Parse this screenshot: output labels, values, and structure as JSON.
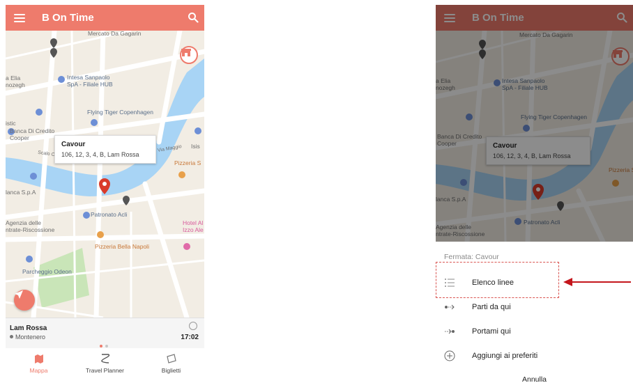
{
  "app": {
    "title": "B On Time"
  },
  "map_labels": {
    "mercato": "Mercato Da Gagarin",
    "elia": "a Elia\nnozegh",
    "intesa": "Intesa Sanpaolo\nSpA - Filiale HUB",
    "flying": "Flying Tiger Copenhagen",
    "banca_credito": "Banca Di Credito\nCooper",
    "istic": "istic",
    "banca_spa": "lanca S.p.A",
    "agenzia": "Agenzia delle\nntrate-Riscossione",
    "patronato": "Patronato Acli",
    "pizzeria_napoli": "Pizzeria Bella Napoli",
    "parcheggio": "Parcheggio Odeon",
    "hotel": "Hotel Al\nIzzo Ale",
    "pizzeria_s": "Pizzeria S",
    "via_maggio": "Via Maggio",
    "isis": "Isis",
    "scalo": "Scalo Cav"
  },
  "callout": {
    "title": "Cavour",
    "lines": "106, 12, 3, 4, B, Lam Rossa"
  },
  "infobar": {
    "line": "Lam Rossa",
    "stop": "Montenero",
    "time": "17:02"
  },
  "bottom_nav": [
    {
      "label": "Mappa",
      "icon": "map-icon"
    },
    {
      "label": "Travel Planner",
      "icon": "route-icon"
    },
    {
      "label": "Biglietti",
      "icon": "ticket-icon"
    }
  ],
  "sheet": {
    "title": "Fermata: Cavour",
    "options": [
      {
        "label": "Elenco linee",
        "icon": "list-icon"
      },
      {
        "label": "Parti da qui",
        "icon": "start-here-icon"
      },
      {
        "label": "Portami qui",
        "icon": "take-me-here-icon"
      },
      {
        "label": "Aggiungi ai preferiti",
        "icon": "add-favorite-icon"
      }
    ],
    "cancel": "Annulla"
  },
  "colors": {
    "accent": "#ee7b6c",
    "highlight": "#d9534f",
    "water": "#a8d4f5",
    "park": "#c9e5b8"
  }
}
